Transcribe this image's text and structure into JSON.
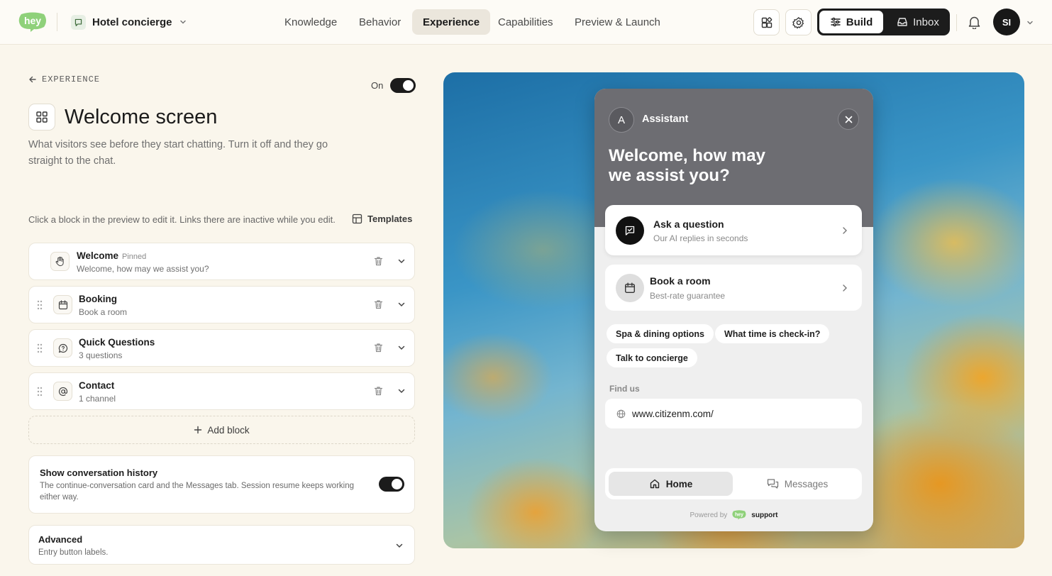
{
  "app": {
    "logo_text": "hey",
    "project_name": "Hotel concierge",
    "nav": [
      "Knowledge",
      "Behavior",
      "Experience",
      "Capabilities",
      "Preview & Launch"
    ],
    "active_nav": "Experience",
    "mode_build": "Build",
    "mode_inbox": "Inbox",
    "user_initials": "SI"
  },
  "editor": {
    "breadcrumb": "EXPERIENCE",
    "toggle_label": "On",
    "toggle_on": true,
    "title": "Welcome screen",
    "description": "What visitors see before they start chatting. Turn it off and they go straight to the chat.",
    "hint": "Click a block in the preview to edit it. Links there are inactive while you edit.",
    "templates_label": "Templates",
    "blocks": [
      {
        "name": "Welcome",
        "pinned_label": "Pinned",
        "subtitle": "Welcome, how may we assist you?",
        "icon": "hand-icon"
      },
      {
        "name": "Booking",
        "subtitle": "Book a room",
        "icon": "calendar-icon"
      },
      {
        "name": "Quick Questions",
        "subtitle": "3 questions",
        "icon": "chat-question-icon"
      },
      {
        "name": "Contact",
        "subtitle": "1 channel",
        "icon": "at-icon"
      }
    ],
    "add_block_label": "Add block",
    "history": {
      "title": "Show conversation history",
      "description": "The continue-conversation card and the Messages tab. Session resume keeps working either way.",
      "enabled": true
    },
    "advanced": {
      "title": "Advanced",
      "description": "Entry button labels."
    }
  },
  "preview": {
    "avatar_letter": "A",
    "assistant_name": "Assistant",
    "welcome_title": "Welcome, how may we assist you?",
    "cards": [
      {
        "title": "Ask a question",
        "subtitle": "Our AI replies in seconds",
        "icon": "chat-check-icon"
      },
      {
        "title": "Book a room",
        "subtitle": "Best-rate guarantee",
        "icon": "calendar-icon"
      }
    ],
    "chips": [
      "Spa & dining options",
      "What time is check-in?",
      "Talk to concierge"
    ],
    "find_us_label": "Find us",
    "url": "www.citizenm.com/",
    "tab_home": "Home",
    "tab_messages": "Messages",
    "powered_by": "Powered by",
    "brand_logo": "hey",
    "brand_name": "support",
    "colors": {
      "header": "#6d6d72",
      "accent": "#1b1b1b",
      "brand_green": "#8fd17a"
    }
  }
}
